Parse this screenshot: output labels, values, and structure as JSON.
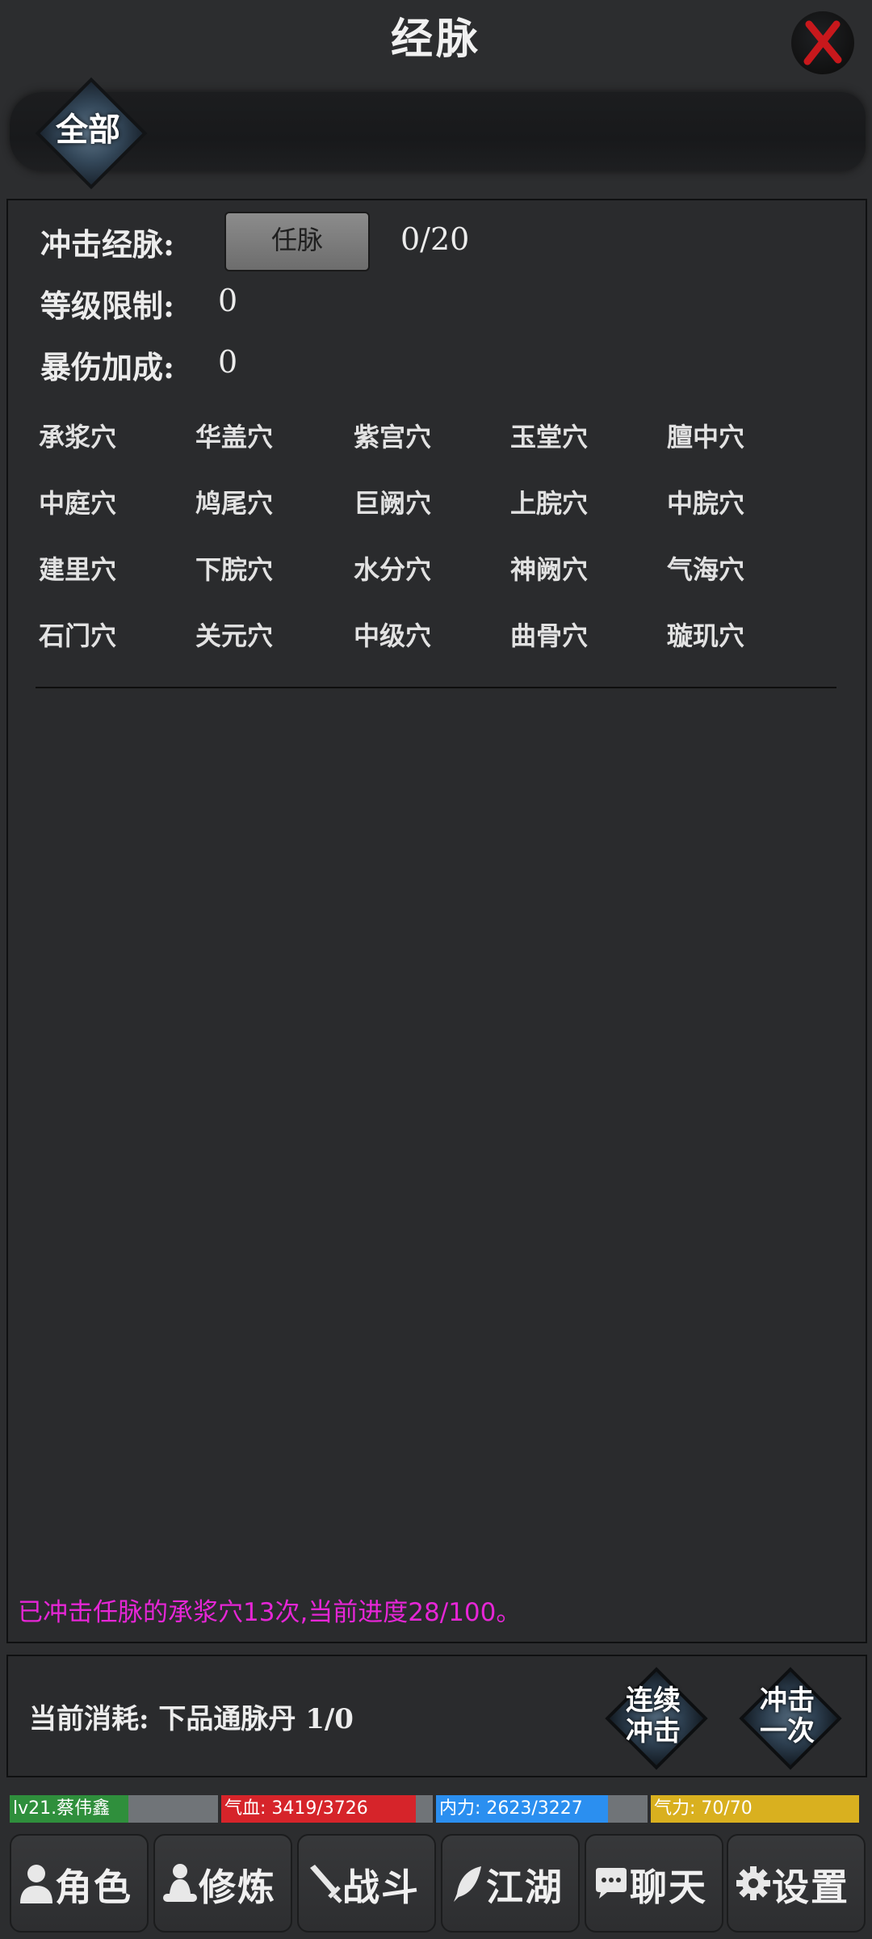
{
  "header": {
    "title": "经脉"
  },
  "tabs": [
    {
      "label": "全部"
    }
  ],
  "meridian": {
    "impact_label": "冲击经脉:",
    "selected_meridian": "任脉",
    "progress": "0/20",
    "level_limit_label": "等级限制:",
    "level_limit_value": "0",
    "crit_bonus_label": "暴伤加成:",
    "crit_bonus_value": "0",
    "acupoints": [
      [
        "承浆穴",
        "华盖穴",
        "紫宫穴",
        "玉堂穴",
        "膻中穴"
      ],
      [
        "中庭穴",
        "鸠尾穴",
        "巨阙穴",
        "上脘穴",
        "中脘穴"
      ],
      [
        "建里穴",
        "下脘穴",
        "水分穴",
        "神阙穴",
        "气海穴"
      ],
      [
        "石门穴",
        "关元穴",
        "中级穴",
        "曲骨穴",
        "璇玑穴"
      ]
    ],
    "log": "已冲击任脉的承浆穴13次,当前进度28/100。"
  },
  "cost": {
    "text": "当前消耗: 下品通脉丹 1/0",
    "continuous_label": [
      "连续",
      "冲击"
    ],
    "once_label": [
      "冲击",
      "一次"
    ]
  },
  "status": {
    "player": {
      "text": "lv21.蔡伟鑫",
      "fill": 0.57,
      "color": "#2f8f3c"
    },
    "hp": {
      "text": "气血: 3419/3726",
      "fill": 0.918,
      "color": "#d6242a"
    },
    "mp": {
      "text": "内力: 2623/3227",
      "fill": 0.813,
      "color": "#2b8ff0"
    },
    "stamina": {
      "text": "气力: 70/70",
      "fill": 1.0,
      "color": "#d9b01f"
    }
  },
  "nav": [
    {
      "label": "角色",
      "icon": "person-icon"
    },
    {
      "label": "修炼",
      "icon": "meditate-icon"
    },
    {
      "label": "战斗",
      "icon": "sword-icon"
    },
    {
      "label": "江湖",
      "icon": "feather-icon"
    },
    {
      "label": "聊天",
      "icon": "chat-icon"
    },
    {
      "label": "设置",
      "icon": "gear-icon"
    }
  ],
  "colors": {
    "log": "#e626d6",
    "background": "#2c2d2f"
  }
}
